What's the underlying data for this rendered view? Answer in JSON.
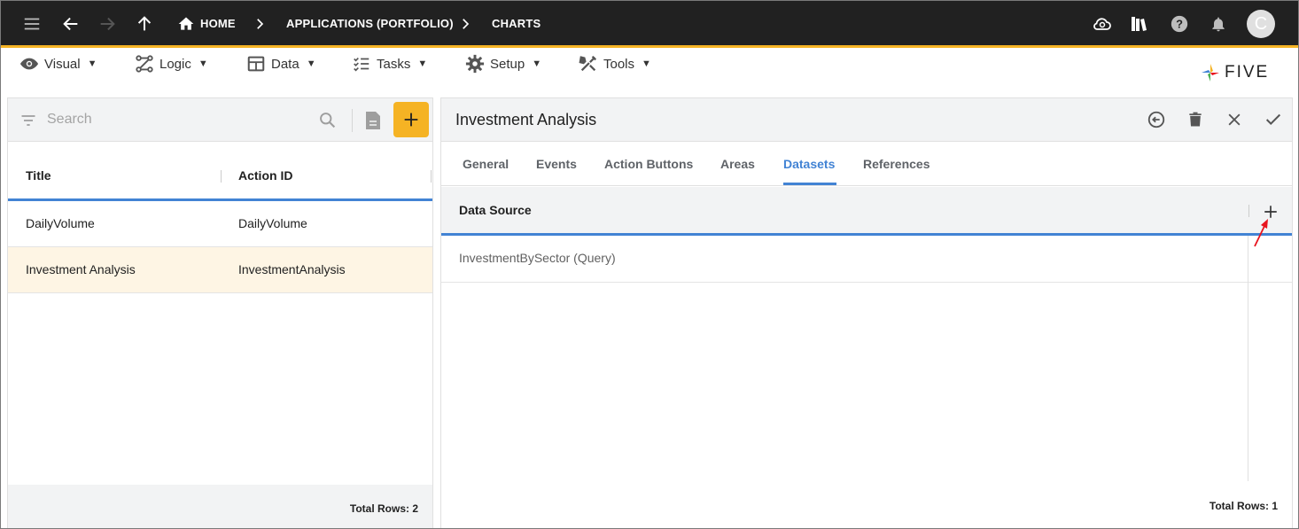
{
  "topbar": {
    "breadcrumbs": [
      "HOME",
      "APPLICATIONS (PORTFOLIO)",
      "CHARTS"
    ],
    "avatar_initial": "C"
  },
  "menu": {
    "items": [
      {
        "label": "Visual",
        "icon": "eye-icon"
      },
      {
        "label": "Logic",
        "icon": "logic-icon"
      },
      {
        "label": "Data",
        "icon": "table-icon"
      },
      {
        "label": "Tasks",
        "icon": "tasks-icon"
      },
      {
        "label": "Setup",
        "icon": "gear-icon"
      },
      {
        "label": "Tools",
        "icon": "tools-icon"
      }
    ],
    "caret": "▼"
  },
  "logo": {
    "text": "FIVE"
  },
  "left": {
    "search_placeholder": "Search",
    "columns": [
      "Title",
      "Action ID"
    ],
    "rows": [
      {
        "title": "DailyVolume",
        "action_id": "DailyVolume"
      },
      {
        "title": "Investment Analysis",
        "action_id": "InvestmentAnalysis"
      }
    ],
    "total_rows": "Total Rows: 2"
  },
  "right": {
    "title": "Investment Analysis",
    "tabs": [
      "General",
      "Events",
      "Action Buttons",
      "Areas",
      "Datasets",
      "References"
    ],
    "active_tab": "Datasets",
    "datasets": {
      "column": "Data Source",
      "rows": [
        "InvestmentBySector (Query)"
      ],
      "total_rows": "Total Rows: 1"
    }
  },
  "colors": {
    "topbar_bg": "#212121",
    "accent": "#f5b324",
    "active_blue": "#4283d4",
    "selected_row": "#fef5e4",
    "annotation_arrow": "#e8141e"
  }
}
